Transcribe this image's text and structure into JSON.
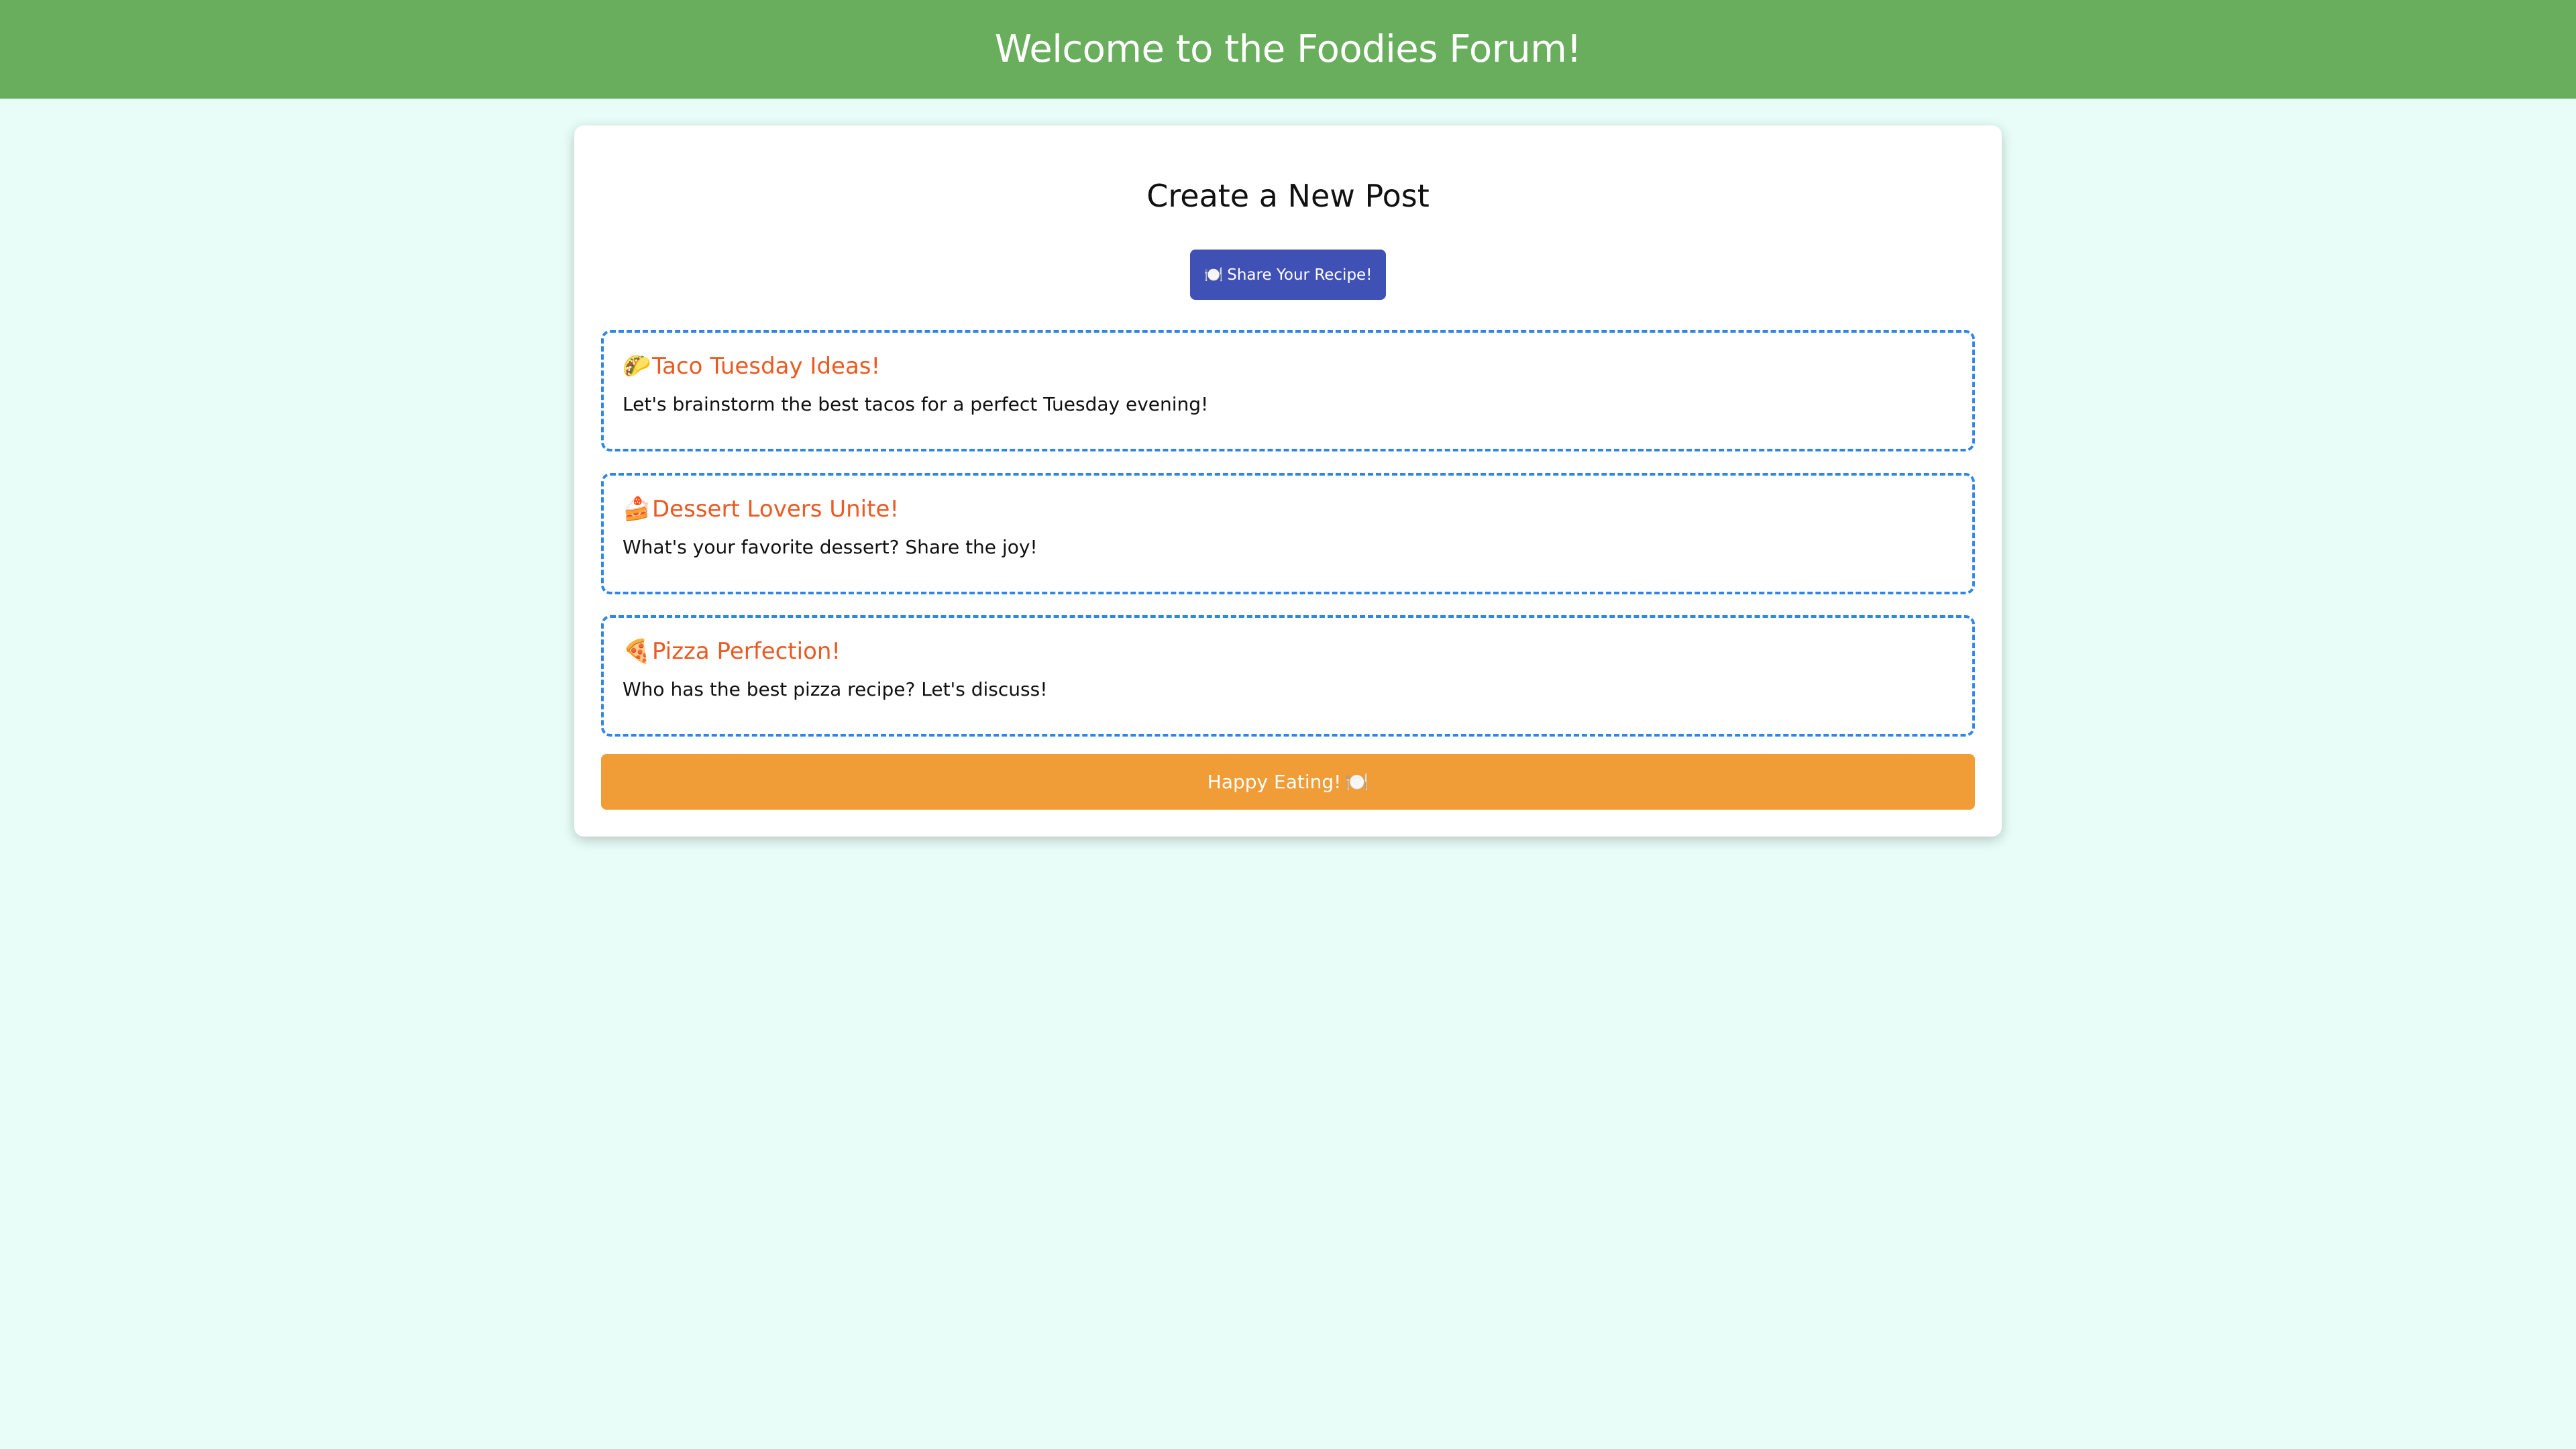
{
  "header": {
    "title": "Welcome to the Foodies Forum!"
  },
  "create": {
    "title": "Create a New Post",
    "button_icon": "🍽️",
    "button_label": "Share Your Recipe!"
  },
  "posts": [
    {
      "icon": "🌮",
      "title": "Taco Tuesday Ideas!",
      "body": "Let's brainstorm the best tacos for a perfect Tuesday evening!"
    },
    {
      "icon": "🍰",
      "title": "Dessert Lovers Unite!",
      "body": "What's your favorite dessert? Share the joy!"
    },
    {
      "icon": "🍕",
      "title": "Pizza Perfection!",
      "body": "Who has the best pizza recipe? Let's discuss!"
    }
  ],
  "footer": {
    "text": "Happy Eating!",
    "icon": "🍽️"
  },
  "colors": {
    "header_bg": "#68ae5d",
    "page_bg": "#e8fdf7",
    "button_bg": "#3f51b5",
    "post_border": "#2f86e6",
    "post_title": "#ea5a22",
    "footer_bg": "#f19d37"
  }
}
